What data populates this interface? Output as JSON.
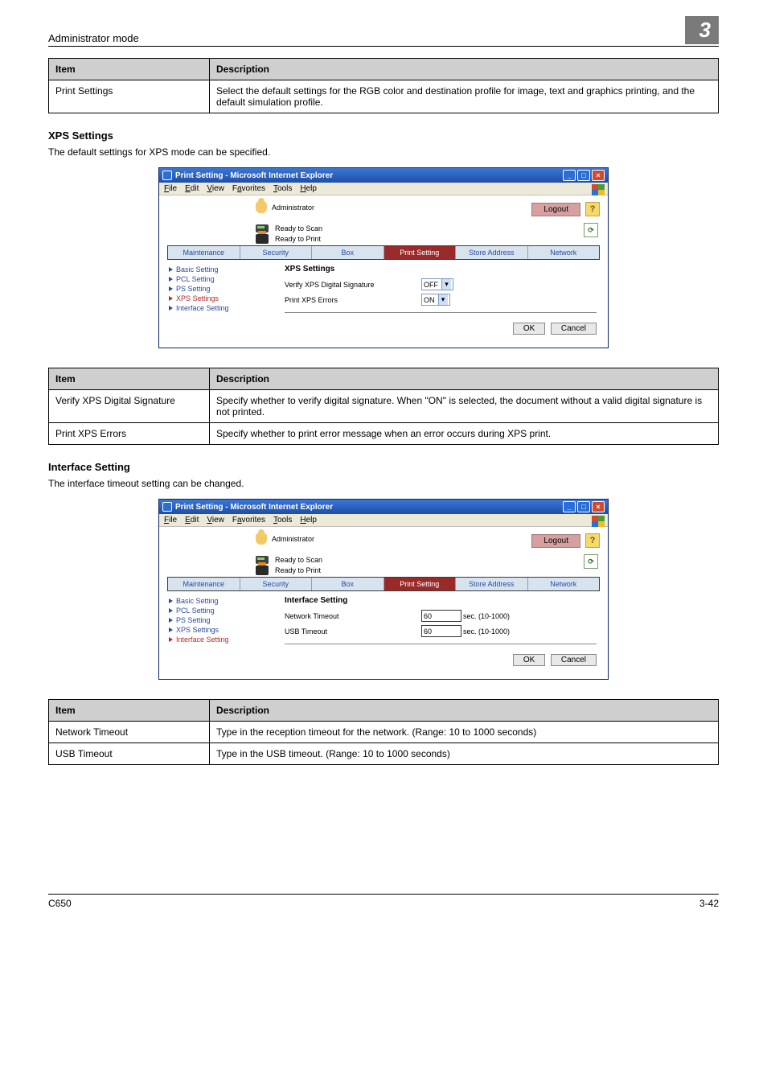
{
  "header": {
    "mode": "Administrator mode",
    "chapter": "3"
  },
  "table1": {
    "headers": [
      "Item",
      "Description"
    ],
    "rows": [
      {
        "item": "Print Settings",
        "desc": "Select the default settings for the RGB color and destination profile for image, text and graphics printing, and the default simulation profile."
      }
    ]
  },
  "xps": {
    "heading": "XPS Settings",
    "intro": "The default settings for XPS mode can be specified."
  },
  "browser": {
    "title": "Print Setting - Microsoft Internet Explorer",
    "menu": {
      "file": "File",
      "edit": "Edit",
      "view": "View",
      "favorites": "Favorites",
      "tools": "Tools",
      "help": "Help"
    },
    "administrator": "Administrator",
    "logout": "Logout",
    "help": "?",
    "status": {
      "scan": "Ready to Scan",
      "print": "Ready to Print"
    },
    "refresh": "⟳",
    "tabs": [
      "Maintenance",
      "Security",
      "Box",
      "Print Setting",
      "Store Address",
      "Network"
    ]
  },
  "ss1": {
    "nav": [
      "Basic Setting",
      "PCL Setting",
      "PS Setting",
      "XPS Settings",
      "Interface Setting"
    ],
    "nav_active_index": 3,
    "panel_title": "XPS Settings",
    "rows": {
      "verify_label": "Verify XPS Digital Signature",
      "verify_value": "OFF",
      "err_label": "Print XPS Errors",
      "err_value": "ON"
    },
    "buttons": {
      "ok": "OK",
      "cancel": "Cancel"
    }
  },
  "table2": {
    "headers": [
      "Item",
      "Description"
    ],
    "rows": [
      {
        "item": "Verify XPS Digital Signature",
        "desc": "Specify whether to verify digital signature. When \"ON\" is selected, the document without a valid digital signature is not printed."
      },
      {
        "item": "Print XPS Errors",
        "desc": "Specify whether to print error message when an error occurs during XPS print."
      }
    ]
  },
  "iface": {
    "heading": "Interface Setting",
    "intro": "The interface timeout setting can be changed."
  },
  "ss2": {
    "nav": [
      "Basic Setting",
      "PCL Setting",
      "PS Setting",
      "XPS Settings",
      "Interface Setting"
    ],
    "nav_active_index": 4,
    "panel_title": "Interface Setting",
    "rows": {
      "net_label": "Network Timeout",
      "net_value": "60",
      "net_hint": "sec. (10-1000)",
      "usb_label": "USB Timeout",
      "usb_value": "60",
      "usb_hint": "sec. (10-1000)"
    },
    "buttons": {
      "ok": "OK",
      "cancel": "Cancel"
    }
  },
  "table3": {
    "headers": [
      "Item",
      "Description"
    ],
    "rows": [
      {
        "item": "Network Timeout",
        "desc": "Type in the reception timeout for the network. (Range: 10 to 1000 seconds)"
      },
      {
        "item": "USB Timeout",
        "desc": "Type in the USB timeout. (Range: 10 to 1000 seconds)"
      }
    ]
  },
  "footer": {
    "model": "C650",
    "page": "3-42"
  }
}
